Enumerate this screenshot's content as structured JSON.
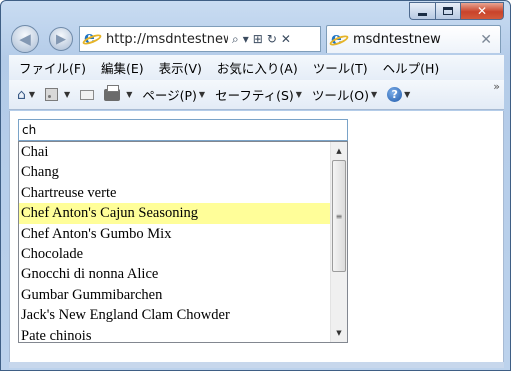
{
  "window": {
    "caption_close": "✕"
  },
  "navbar": {
    "back_glyph": "◀",
    "forward_glyph": "▶",
    "address_url": "http://msdntestnew/",
    "address_icons": [
      "search-icon",
      "dropdown-icon",
      "compat-icon",
      "refresh-icon",
      "stop-icon"
    ],
    "search_glyph": "⌕",
    "dropdown_glyph": "▾",
    "compat_glyph": "⊞",
    "refresh_glyph": "↻",
    "stop_glyph": "✕"
  },
  "tab": {
    "title": "msdntestnew",
    "close_glyph": "✕"
  },
  "menu": {
    "items": [
      "ファイル(F)",
      "編集(E)",
      "表示(V)",
      "お気に入り(A)",
      "ツール(T)",
      "ヘルプ(H)"
    ]
  },
  "commandbar": {
    "home_glyph": "⌂",
    "arrow_glyph": "▼",
    "page_label": "ページ(P)",
    "safety_label": "セーフティ(S)",
    "tools_label": "ツール(O)",
    "help_glyph": "?",
    "chevron": "»"
  },
  "autocomplete": {
    "input_value": "ch",
    "selected_index": 3,
    "items": [
      "Chai",
      "Chang",
      "Chartreuse verte",
      "Chef Anton's Cajun Seasoning",
      "Chef Anton's Gumbo Mix",
      "Chocolade",
      "Gnocchi di nonna Alice",
      "Gumbar Gummibarchen",
      "Jack's New England Clam Chowder",
      "Pate chinois"
    ],
    "selected_color": "#fffe99"
  },
  "scrollbar": {
    "up_glyph": "▲",
    "down_glyph": "▼",
    "thumb_grip": "≡"
  }
}
